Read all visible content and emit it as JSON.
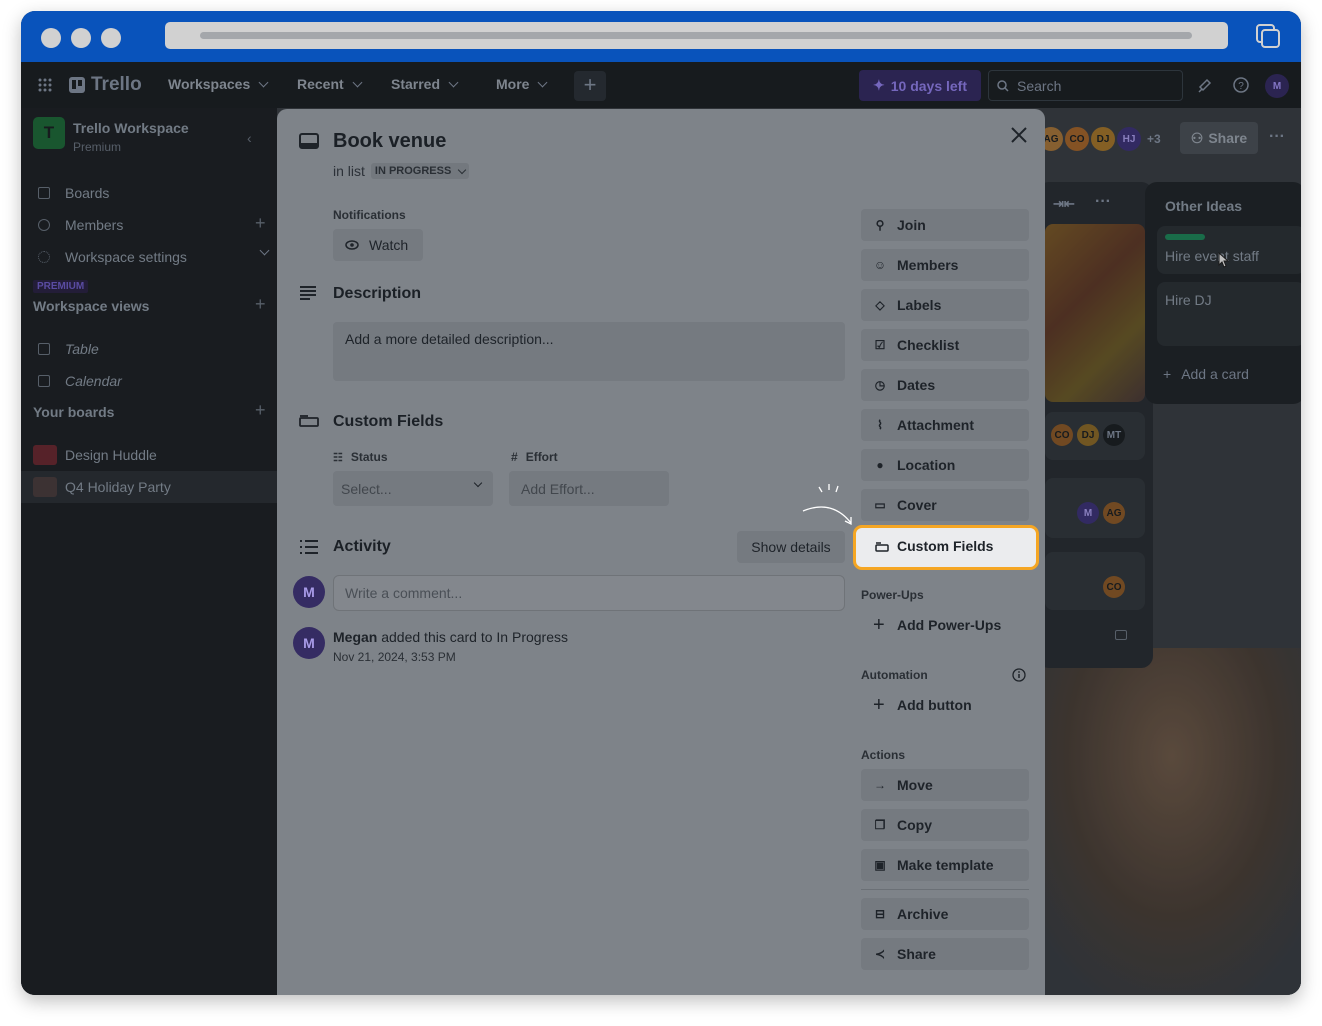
{
  "colors": {
    "accent_browser": "#0c66e4",
    "highlight": "#f5a623",
    "premium_badge": "#9f8fef",
    "status_green": "#1f845a"
  },
  "topnav": {
    "logo": "Trello",
    "workspaces": "Workspaces",
    "recent": "Recent",
    "starred": "Starred",
    "more": "More",
    "trial": "10 days left",
    "search_placeholder": "Search",
    "user_initial": "M"
  },
  "sidebar": {
    "workspace_initial": "T",
    "workspace_name": "Trello Workspace",
    "workspace_plan": "Premium",
    "items": [
      {
        "label": "Boards",
        "icon": "board-icon"
      },
      {
        "label": "Members",
        "icon": "person-icon"
      },
      {
        "label": "Workspace settings",
        "icon": "gear-icon"
      }
    ],
    "premium_badge": "PREMIUM",
    "views_title": "Workspace views",
    "views": [
      {
        "label": "Table"
      },
      {
        "label": "Calendar"
      }
    ],
    "boards_title": "Your boards",
    "boards": [
      {
        "label": "Design Huddle"
      },
      {
        "label": "Q4 Holiday Party"
      }
    ]
  },
  "board_header": {
    "avatars": [
      "AG",
      "CO",
      "DJ",
      "HJ"
    ],
    "more_count": "+3",
    "share": "Share"
  },
  "other_list": {
    "title": "Other Ideas",
    "cards": [
      "Hire event staff",
      "Hire DJ"
    ],
    "add_card": "Add a card"
  },
  "card_avatars": {
    "row1": [
      "CO",
      "DJ",
      "MT"
    ],
    "row2": [
      "M",
      "AG"
    ],
    "row3": [
      "CO"
    ]
  },
  "modal": {
    "title": "Book venue",
    "in_list_prefix": "in list",
    "list_name": "IN PROGRESS",
    "notifications_label": "Notifications",
    "watch": "Watch",
    "description_title": "Description",
    "description_placeholder": "Add a more detailed description...",
    "custom_fields_title": "Custom Fields",
    "fields": [
      {
        "name": "Status",
        "value": "Select..."
      },
      {
        "name": "Effort",
        "value": "Add Effort..."
      }
    ],
    "activity_title": "Activity",
    "show_details": "Show details",
    "comment_placeholder": "Write a comment...",
    "activity_user_initial": "M",
    "activity_user": "Megan",
    "activity_text": "added this card to In Progress",
    "activity_time": "Nov 21, 2024, 3:53 PM"
  },
  "side_actions": {
    "add_to_card": [
      "Join",
      "Members",
      "Labels",
      "Checklist",
      "Dates",
      "Attachment",
      "Location",
      "Cover"
    ],
    "highlighted": "Custom Fields",
    "powerups_label": "Power-Ups",
    "add_powerups": "Add Power-Ups",
    "automation_label": "Automation",
    "add_button": "Add button",
    "actions_label": "Actions",
    "actions": [
      "Move",
      "Copy",
      "Make template"
    ],
    "actions_more": [
      "Archive",
      "Share"
    ]
  }
}
